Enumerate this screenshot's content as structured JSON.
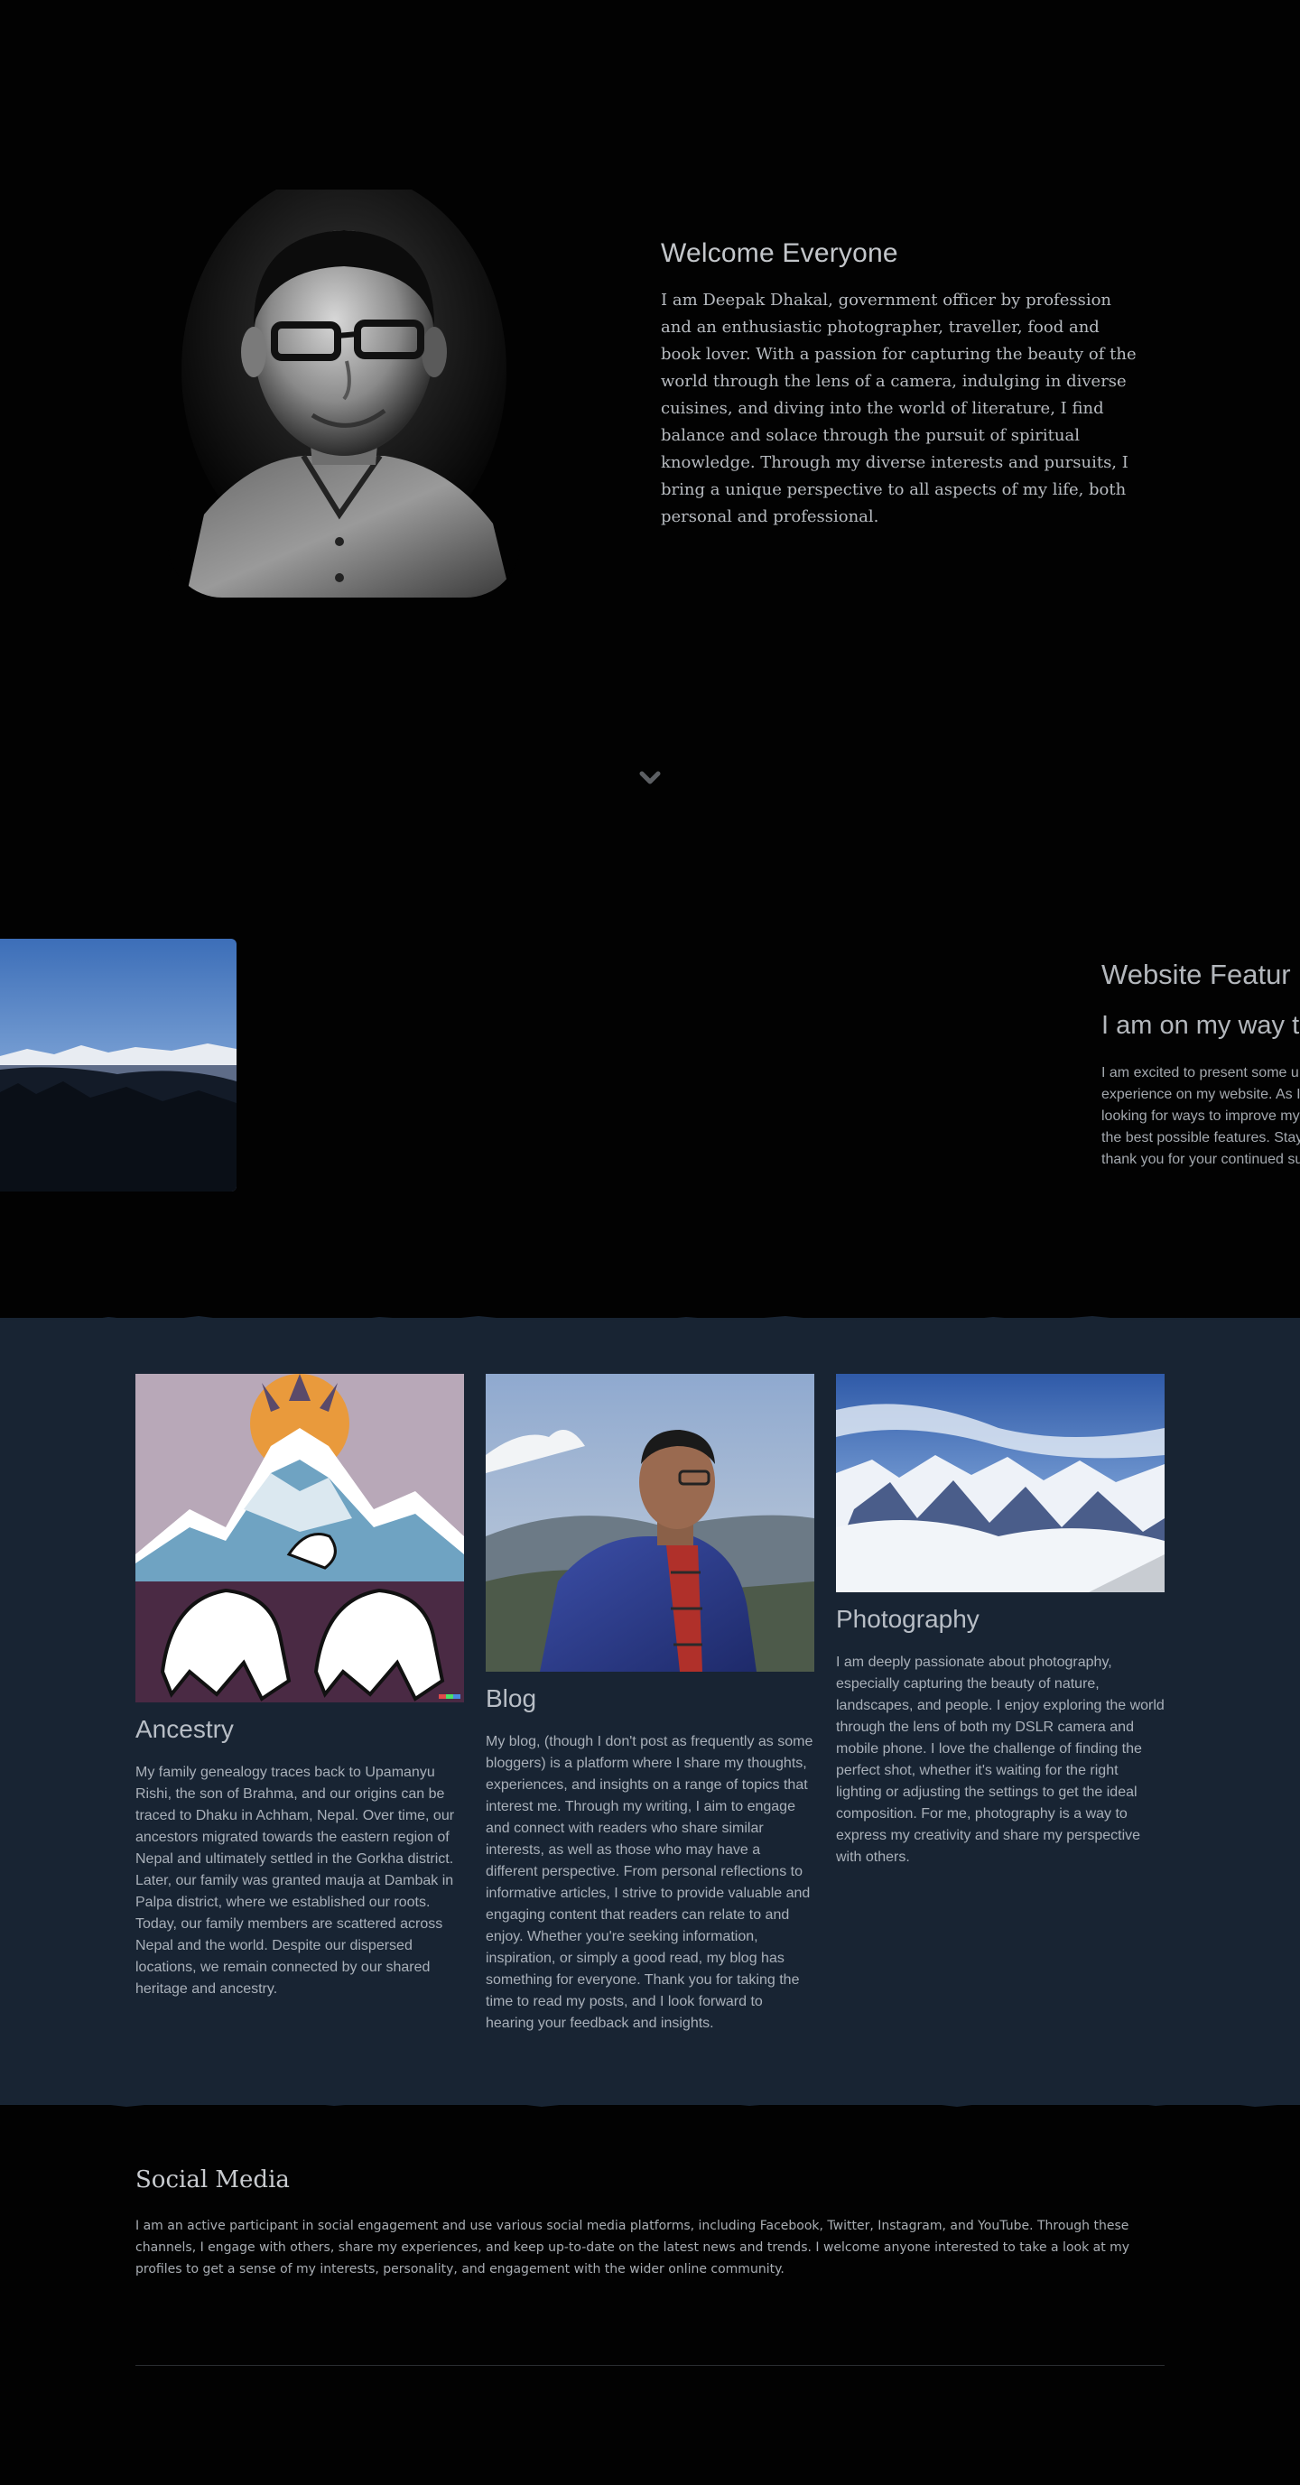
{
  "hero": {
    "title": "Welcome Everyone",
    "body": "I am Deepak Dhakal, government officer by profession and an enthusiastic photographer, traveller, food and book lover. With a passion for capturing the beauty of the world through the lens of a camera, indulging in diverse cuisines, and diving into the world of literature, I find balance and solace through the pursuit of spiritual knowledge. Through my diverse interests and pursuits, I bring a unique perspective to all aspects of my life, both personal and professional.",
    "scroll_icon": "chevron-down-icon"
  },
  "features": {
    "title": "Website Featur",
    "subtitle": "I am on my way to",
    "body_lines": [
      "I am excited to present some u",
      "experience on my website. As I",
      "looking for ways to improve my",
      "the best possible features. Stay",
      "thank you for your continued su"
    ]
  },
  "cards": [
    {
      "title": "Ancestry",
      "body": "My family genealogy traces back to Upamanyu Rishi, the son of Brahma, and our origins can be traced to Dhaku in Achham, Nepal. Over time, our ancestors migrated towards the eastern region of Nepal and ultimately settled in the Gorkha district. Later, our family was granted mauja at Dambak in Palpa district, where we established our roots. Today, our family members are scattered across Nepal and the world. Despite our dispersed locations, we remain connected by our shared heritage and ancestry."
    },
    {
      "title": "Blog",
      "body": "My blog, (though I don't post as frequently as some bloggers) is a platform where I share my thoughts, experiences, and insights on a range of topics that interest me. Through my writing, I aim to engage and connect with readers who share similar interests, as well as those who may have a different perspective. From personal reflections to informative articles, I strive to provide valuable and engaging content that readers can relate to and enjoy. Whether you're seeking information, inspiration, or simply a good read, my blog has something for everyone. Thank you for taking the time to read my posts, and I look forward to hearing your feedback and insights."
    },
    {
      "title": "Photography",
      "body": "I am deeply passionate about photography, especially capturing the beauty of nature, landscapes, and people. I enjoy exploring the world through the lens of both my DSLR camera and mobile phone. I love the challenge of finding the perfect shot, whether it's waiting for the right lighting or adjusting the settings to get the ideal composition. For me, photography is a way to express my creativity and share my perspective with others."
    }
  ],
  "social": {
    "title": "Social Media",
    "body": "I am an active participant in social engagement and use various social media platforms, including Facebook, Twitter, Instagram, and YouTube. Through these channels, I engage with others, share my experiences, and keep up-to-date on the latest news and trends. I welcome anyone interested to take a look at my profiles to get a sense of my interests, personality, and engagement with the wider online community."
  },
  "colors": {
    "page_bg": "#020202",
    "section_bg": "#182433",
    "heading": "#c3c6ca",
    "text": "#a9b0b9"
  }
}
